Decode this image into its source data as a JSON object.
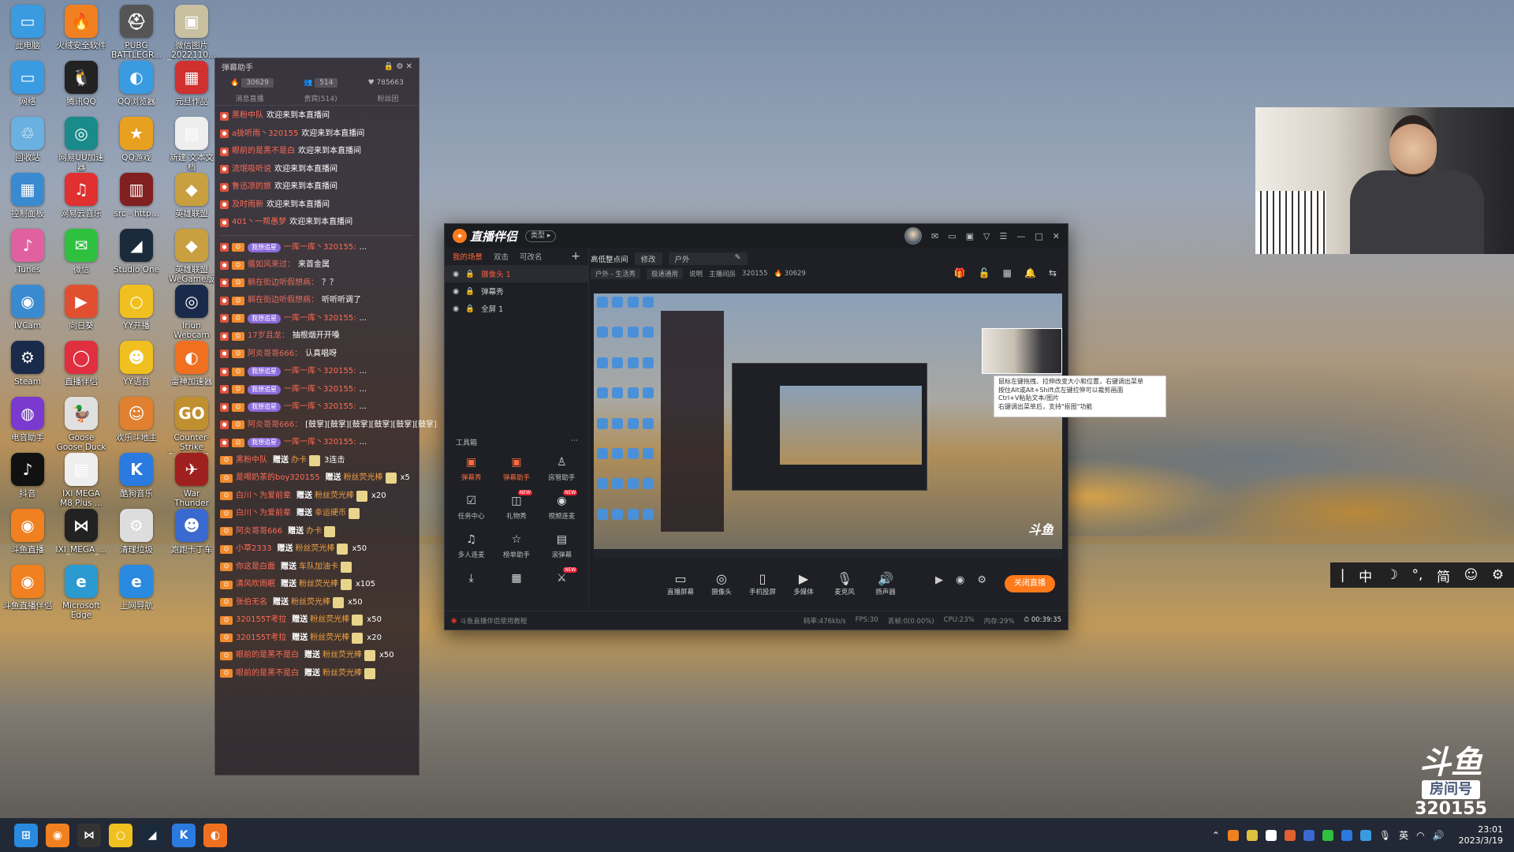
{
  "desktop_icons": [
    {
      "label": "此电脑",
      "color": "#3a9be0",
      "glyph": "▭",
      "icon": "computer-icon"
    },
    {
      "label": "火绒安全软件",
      "color": "#f08020",
      "glyph": "🔥",
      "icon": "huorong-icon"
    },
    {
      "label": "PUBG BATTLEGR...",
      "color": "#555",
      "glyph": "⛑",
      "icon": "pubg-icon"
    },
    {
      "label": "微信图片_2022110...",
      "color": "#c8c0a0",
      "glyph": "▣",
      "icon": "image-file-icon"
    },
    {
      "label": "网络",
      "color": "#3a9be0",
      "glyph": "▭",
      "icon": "network-icon"
    },
    {
      "label": "腾讯QQ",
      "color": "#222",
      "glyph": "🐧",
      "icon": "qq-icon"
    },
    {
      "label": "QQ浏览器",
      "color": "#3a9be0",
      "glyph": "◐",
      "icon": "qq-browser-icon"
    },
    {
      "label": "元旦作品",
      "color": "#d03030",
      "glyph": "▦",
      "icon": "folder-app-icon"
    },
    {
      "label": "回收站",
      "color": "#6ab0e0",
      "glyph": "♲",
      "icon": "recycle-bin-icon"
    },
    {
      "label": "网易UU加速器",
      "color": "#1a8a8a",
      "glyph": "◎",
      "icon": "uu-accelerator-icon"
    },
    {
      "label": "QQ游戏",
      "color": "#e8a020",
      "glyph": "★",
      "icon": "qq-game-icon"
    },
    {
      "label": "新建 文本文档",
      "color": "#eee",
      "glyph": "▤",
      "icon": "text-file-icon"
    },
    {
      "label": "控制面板",
      "color": "#3a8ad0",
      "glyph": "▦",
      "icon": "control-panel-icon"
    },
    {
      "label": "网易云音乐",
      "color": "#e03030",
      "glyph": "♫",
      "icon": "netease-music-icon"
    },
    {
      "label": "src - http...",
      "color": "#802020",
      "glyph": "▥",
      "icon": "link-file-icon"
    },
    {
      "label": "英雄联盟",
      "color": "#c8a040",
      "glyph": "◆",
      "icon": "lol-icon"
    },
    {
      "label": "iTunes",
      "color": "#e060a0",
      "glyph": "♪",
      "icon": "itunes-icon"
    },
    {
      "label": "微信",
      "color": "#30c040",
      "glyph": "✉",
      "icon": "wechat-icon"
    },
    {
      "label": "Studio One",
      "color": "#1a2a3a",
      "glyph": "◢",
      "icon": "studio-one-icon"
    },
    {
      "label": "英雄联盟WeGame版",
      "color": "#c8a040",
      "glyph": "◆",
      "icon": "lol-wegame-icon"
    },
    {
      "label": "IVCam",
      "color": "#3a8ad0",
      "glyph": "◉",
      "icon": "ivcam-icon"
    },
    {
      "label": "向日葵",
      "color": "#e05030",
      "glyph": "▶",
      "icon": "sunflower-icon"
    },
    {
      "label": "YY开播",
      "color": "#f0c020",
      "glyph": "○",
      "icon": "yy-live-icon"
    },
    {
      "label": "Iriun Webcam",
      "color": "#1a2a4a",
      "glyph": "◎",
      "icon": "iriun-icon"
    },
    {
      "label": "Steam",
      "color": "#1a2a4a",
      "glyph": "⚙",
      "icon": "steam-icon"
    },
    {
      "label": "直播伴侣",
      "color": "#e03040",
      "glyph": "◯",
      "icon": "live-companion-icon"
    },
    {
      "label": "YY语音",
      "color": "#f0c020",
      "glyph": "☻",
      "icon": "yy-voice-icon"
    },
    {
      "label": "雷神加速器",
      "color": "#f07020",
      "glyph": "◐",
      "icon": "leishen-icon"
    },
    {
      "label": "电音助手",
      "color": "#7a3ad0",
      "glyph": "◍",
      "icon": "audio-helper-icon"
    },
    {
      "label": "Goose Goose Duck",
      "color": "#e0e0e0",
      "glyph": "🦆",
      "icon": "goose-icon"
    },
    {
      "label": "欢乐斗地主",
      "color": "#e08030",
      "glyph": "☺",
      "icon": "doudizhu-icon"
    },
    {
      "label": "Counter-Strike Global Off...",
      "color": "#c09030",
      "glyph": "GO",
      "icon": "csgo-icon"
    },
    {
      "label": "抖音",
      "color": "#111",
      "glyph": "♪",
      "icon": "douyin-icon"
    },
    {
      "label": "IXI MEGA M8 Plus ...",
      "color": "#eee",
      "glyph": "▤",
      "icon": "pdf-icon"
    },
    {
      "label": "酷狗音乐",
      "color": "#2a7ae0",
      "glyph": "K",
      "icon": "kugou-icon"
    },
    {
      "label": "War Thunder",
      "color": "#a02020",
      "glyph": "✈",
      "icon": "war-thunder-icon"
    },
    {
      "label": "斗鱼直播",
      "color": "#f08020",
      "glyph": "◉",
      "icon": "douyu-icon"
    },
    {
      "label": "IXI_MEGA_...",
      "color": "#222",
      "glyph": "⋈",
      "icon": "ixi-mega-icon"
    },
    {
      "label": "清理垃圾",
      "color": "#ddd",
      "glyph": "⚙",
      "icon": "cleanup-icon"
    },
    {
      "label": "跑跑卡丁车",
      "color": "#3a6ad0",
      "glyph": "☻",
      "icon": "kart-icon"
    },
    {
      "label": "斗鱼直播伴侣",
      "color": "#f08020",
      "glyph": "◉",
      "icon": "douyu-companion-icon"
    },
    {
      "label": "Microsoft Edge",
      "color": "#2a9ad0",
      "glyph": "e",
      "icon": "edge-icon"
    },
    {
      "label": "上网导航",
      "color": "#2a8ae0",
      "glyph": "e",
      "icon": "ie-icon"
    }
  ],
  "danmu": {
    "title": "弹幕助手",
    "stat_hot": "30629",
    "stat_people": "514",
    "stat_fans": "785663",
    "tab_gift": "消息直播",
    "tab_member": "贵宾(514)",
    "tab_fans": "粉丝团",
    "welcome": [
      {
        "user": "黑粉中队",
        "text": "欢迎来到本直播间"
      },
      {
        "user": "a拢听雨丶320155",
        "text": "欢迎来到本直播间"
      },
      {
        "user": "眼前的是黑不是白",
        "text": "欢迎来到本直播间"
      },
      {
        "user": "流氓吸听说",
        "text": "欢迎来到本直播间"
      },
      {
        "user": "鲁迅凉的旅",
        "text": "欢迎来到本直播间"
      },
      {
        "user": "及时雨新",
        "text": "欢迎来到本直播间"
      },
      {
        "user": "401丶一帮愚梦",
        "text": "欢迎来到本直播间"
      }
    ],
    "chat": [
      {
        "fans": "我想追星",
        "user": "一库一库丶320155:",
        "text": "..."
      },
      {
        "user": "循如风来过：",
        "text": "来首金属"
      },
      {
        "user": "躺在街边听假想病：",
        "text": "？？"
      },
      {
        "user": "躺在街边听假想病：",
        "text": "听听听调了"
      },
      {
        "fans": "我想追星",
        "user": "一库一库丶320155:",
        "text": "..."
      },
      {
        "user": "17岁且龙：",
        "text": "抽根烟开开嗓"
      },
      {
        "user": "阿炎哥哥666：",
        "text": "认真唱呀"
      },
      {
        "fans": "我想追星",
        "user": "一库一库丶320155:",
        "text": "..."
      },
      {
        "fans": "我想追星",
        "user": "一库一库丶320155:",
        "text": "..."
      },
      {
        "fans": "我想追星",
        "user": "一库一库丶320155:",
        "text": "..."
      },
      {
        "user": "阿炎哥哥666：",
        "text": "[鼓掌][鼓掌][鼓掌][鼓掌][鼓掌][鼓掌]"
      },
      {
        "fans": "我想追星",
        "user": "一库一库丶320155:",
        "text": "..."
      }
    ],
    "gifts": [
      {
        "user": "黑粉中队",
        "verb": "赠送",
        "gift": "办卡",
        "count": "3连击"
      },
      {
        "user": "是喝奶茶的boy320155",
        "verb": "赠送",
        "gift": "粉丝荧光棒",
        "count": "x5"
      },
      {
        "user": "白川丶为爱前辈",
        "verb": "赠送",
        "gift": "粉丝荧光棒",
        "count": "x20"
      },
      {
        "user": "白川丶为爱前辈",
        "verb": "赠送",
        "gift": "幸运硬币",
        "count": ""
      },
      {
        "user": "阿炎哥哥666",
        "verb": "赠送",
        "gift": "办卡",
        "count": ""
      },
      {
        "user": "小草2333",
        "verb": "赠送",
        "gift": "粉丝荧光棒",
        "count": "x50"
      },
      {
        "user": "你这是白面",
        "verb": "赠送",
        "gift": "车队加油卡",
        "count": ""
      },
      {
        "user": "清风吹雨眠",
        "verb": "赠送",
        "gift": "粉丝荧光棒",
        "count": "x105"
      },
      {
        "user": "张伯无名",
        "verb": "赠送",
        "gift": "粉丝荧光棒",
        "count": "x50"
      },
      {
        "user": "320155T考拉",
        "verb": "赠送",
        "gift": "粉丝荧光棒",
        "count": "x50"
      },
      {
        "user": "320155T考拉",
        "verb": "赠送",
        "gift": "粉丝荧光棒",
        "count": "x20"
      },
      {
        "user": "眼前的是黑不是白",
        "verb": "赠送",
        "gift": "粉丝荧光棒",
        "count": "x50"
      },
      {
        "user": "眼前的是黑不是白",
        "verb": "赠送",
        "gift": "粉丝荧光棒",
        "count": ""
      }
    ]
  },
  "app": {
    "title": "直播伴侣",
    "type_btn": "类型 ▸",
    "scene_tabs": [
      "我的场景",
      "双击",
      "可改名"
    ],
    "sources": [
      {
        "name": "摄像头 1",
        "selected": true
      },
      {
        "name": "弹幕秀",
        "selected": false
      },
      {
        "name": "全屏 1",
        "selected": false
      }
    ],
    "stream_title": "高低整点间",
    "edit": "修改",
    "category": "户外",
    "sub_category": "户外 - 生活秀",
    "quality": "极速通用",
    "desc": "说明",
    "room_label": "主播间房",
    "room_no": "320155",
    "hot": "30629",
    "tools_title": "工具箱",
    "tools": [
      {
        "label": "弹幕秀",
        "icon": "danmu-show-icon",
        "glyph": "▣",
        "hot": true,
        "new": false
      },
      {
        "label": "弹幕助手",
        "icon": "danmu-helper-icon",
        "glyph": "▣",
        "hot": true,
        "new": false
      },
      {
        "label": "房管助手",
        "icon": "admin-helper-icon",
        "glyph": "♙",
        "hot": false,
        "new": false
      },
      {
        "label": "任务中心",
        "icon": "task-center-icon",
        "glyph": "☑",
        "hot": false,
        "new": false
      },
      {
        "label": "礼物秀",
        "icon": "gift-show-icon",
        "glyph": "◫",
        "hot": false,
        "new": true
      },
      {
        "label": "视频连麦",
        "icon": "video-link-icon",
        "glyph": "◉",
        "hot": false,
        "new": true
      },
      {
        "label": "多人连麦",
        "icon": "multi-link-icon",
        "glyph": "♫",
        "hot": false,
        "new": false
      },
      {
        "label": "榜单助手",
        "icon": "rank-helper-icon",
        "glyph": "☆",
        "hot": false,
        "new": false
      },
      {
        "label": "滚弹幕",
        "icon": "scroll-danmu-icon",
        "glyph": "▤",
        "hot": false,
        "new": false
      },
      {
        "label": "",
        "icon": "download-icon",
        "glyph": "⤓",
        "hot": false,
        "new": false
      },
      {
        "label": "",
        "icon": "board-icon",
        "glyph": "▦",
        "hot": false,
        "new": false
      },
      {
        "label": "",
        "icon": "pk-icon",
        "glyph": "⚔",
        "hot": false,
        "new": true
      }
    ],
    "bottom_tools": [
      {
        "label": "直播屏幕",
        "icon": "screen-capture-icon",
        "glyph": "▭"
      },
      {
        "label": "摄像头",
        "icon": "camera-icon",
        "glyph": "◎"
      },
      {
        "label": "手机投屏",
        "icon": "phone-cast-icon",
        "glyph": "▯"
      },
      {
        "label": "多媒体",
        "icon": "media-icon",
        "glyph": "▶"
      },
      {
        "label": "麦克风",
        "icon": "microphone-icon",
        "glyph": "🎙"
      },
      {
        "label": "扬声器",
        "icon": "speaker-icon",
        "glyph": "🔊"
      }
    ],
    "live_btn": "关闭直播",
    "tutorial": "斗鱼直播伴侣使用教程",
    "stat_bitrate": "码率:476kb/s",
    "stat_fps": "FPS:30",
    "stat_drop": "丢帧:0(0.00%)",
    "stat_cpu": "CPU:23%",
    "stat_mem": "内存:29%",
    "duration": "00:39:35",
    "tooltip": "鼠标左键拖拽、拉伸改变大小和位置，右键调出菜单\n按住Alt或Alt+Shift点左键拉伸可以裁剪画面\nCtrl+V粘贴文本/图片\n右键调出菜单后，支持\"抠图\"功能"
  },
  "ime": {
    "items": [
      "|",
      "中",
      "☽",
      "°,",
      "简",
      "☺",
      "⚙"
    ]
  },
  "brand": {
    "logo": "斗鱼",
    "room_label": "房间号",
    "room_no": "320155"
  },
  "taskbar": {
    "apps": [
      {
        "icon": "windows-start-icon",
        "color": "#2a8ae0",
        "glyph": "⊞"
      },
      {
        "icon": "douyu-taskbar-icon",
        "color": "#f08020",
        "glyph": "◉"
      },
      {
        "icon": "ixi-taskbar-icon",
        "color": "#333",
        "glyph": "⋈"
      },
      {
        "icon": "yy-taskbar-icon",
        "color": "#f0c020",
        "glyph": "○"
      },
      {
        "icon": "studio-one-taskbar-icon",
        "color": "#1a2a3a",
        "glyph": "◢"
      },
      {
        "icon": "kugou-taskbar-icon",
        "color": "#2a7ae0",
        "glyph": "K"
      },
      {
        "icon": "leishen-taskbar-icon",
        "color": "#f07020",
        "glyph": "◐"
      }
    ],
    "lang": "英",
    "time": "23:01",
    "date": "2023/3/19"
  }
}
